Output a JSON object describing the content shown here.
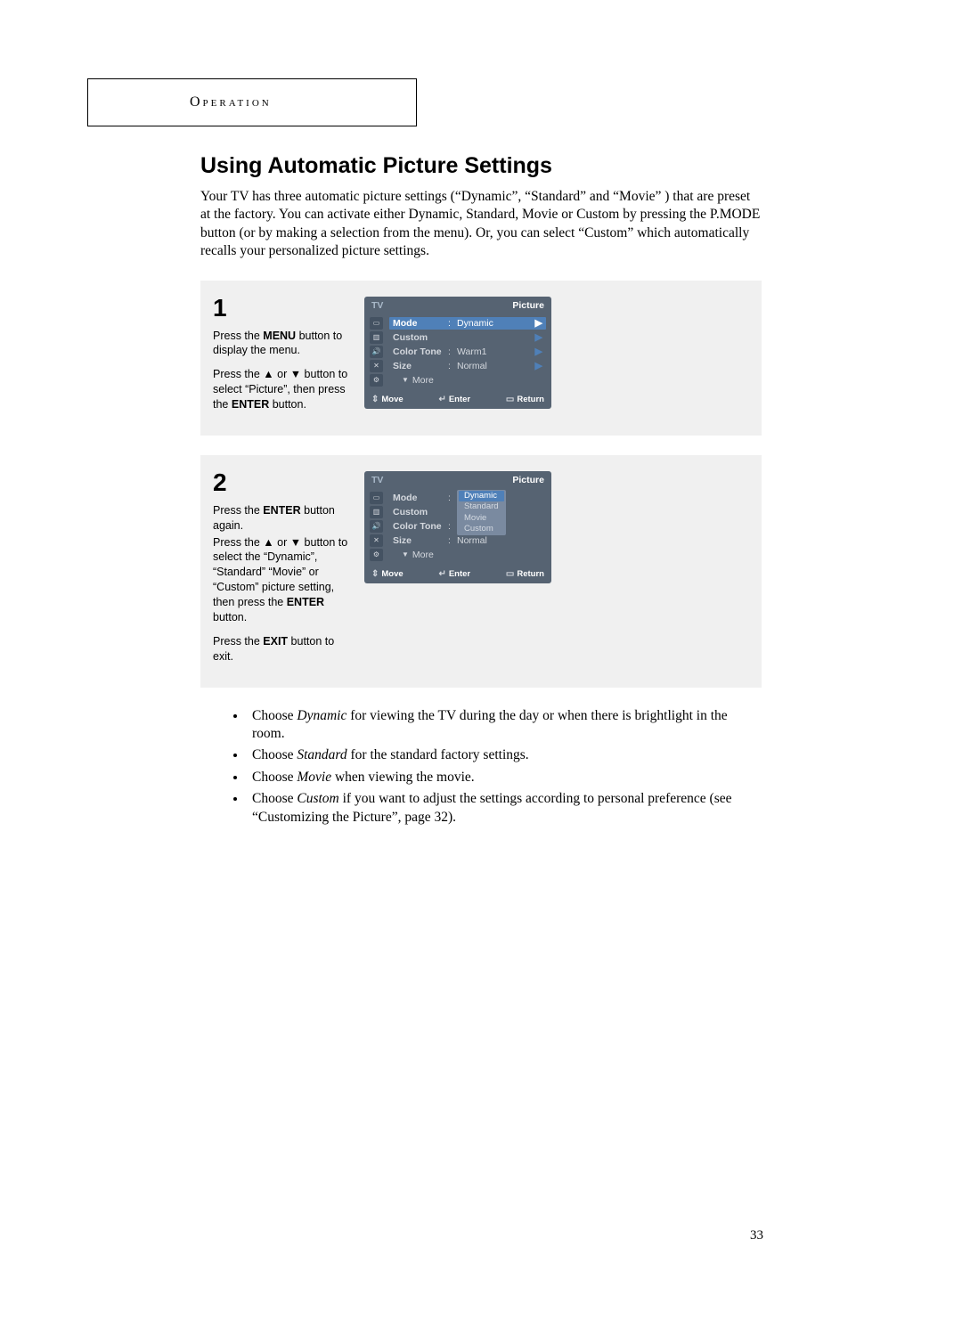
{
  "header": "Operation",
  "title": "Using Automatic Picture Settings",
  "intro": "Your TV has three automatic picture settings (“Dynamic”, “Standard” and “Movie” ) that are preset at the factory. You can activate either Dynamic, Standard, Movie or Custom by pressing the P.MODE button (or by making a selection from the menu). Or, you can select “Custom” which automatically recalls your personalized picture settings.",
  "steps": [
    {
      "num": "1",
      "instructions": [
        {
          "pre": "Press the ",
          "bold": "MENU",
          "post": " button to display the menu."
        },
        {
          "pre": "Press the ▲ or ▼ button to select “Picture”, then press the ",
          "bold": "ENTER",
          "post": " button."
        }
      ],
      "osd": {
        "tv": "TV",
        "title": "Picture",
        "rows": [
          {
            "label": "Mode",
            "val": "Dynamic",
            "hl": true,
            "arrow": true
          },
          {
            "label": "Custom",
            "val": "",
            "arrow": true
          },
          {
            "label": "Color Tone",
            "val": "Warm1",
            "arrow": true
          },
          {
            "label": "Size",
            "val": "Normal",
            "arrow": true
          }
        ],
        "more": "More",
        "footer": {
          "move": "Move",
          "enter": "Enter",
          "ret": "Return"
        }
      }
    },
    {
      "num": "2",
      "instructions": [
        {
          "pre": "Press the ",
          "bold": "ENTER",
          "post": " button again."
        },
        {
          "pre": "Press the ▲ or ▼ button to select the “Dynamic”, “Standard” “Movie” or “Custom” picture setting, then press the ",
          "bold": "ENTER",
          "post": " button."
        },
        {
          "pre": "Press the ",
          "bold": "EXIT",
          "post": " button to exit."
        }
      ],
      "osd": {
        "tv": "TV",
        "title": "Picture",
        "rows": [
          {
            "label": "Mode",
            "val": "",
            "dd": true
          },
          {
            "label": "Custom",
            "val": ""
          },
          {
            "label": "Color Tone",
            "val": ""
          },
          {
            "label": "Size",
            "val": "Normal"
          }
        ],
        "dropdown": [
          "Dynamic",
          "Standard",
          "Movie",
          "Custom"
        ],
        "dd_selected": "Dynamic",
        "more": "More",
        "footer": {
          "move": "Move",
          "enter": "Enter",
          "ret": "Return"
        }
      }
    }
  ],
  "bullets": [
    {
      "pre": "Choose ",
      "em": "Dynamic",
      "post": " for viewing the TV during the day or when there is brightlight in the room."
    },
    {
      "pre": "Choose ",
      "em": "Standard",
      "post": " for the standard factory settings."
    },
    {
      "pre": "Choose ",
      "em": "Movie",
      "post": " when viewing the movie."
    },
    {
      "pre": "Choose ",
      "em": "Custom",
      "post": " if you want to adjust the settings according to personal preference (see “Customizing the Picture”, page 32)."
    }
  ],
  "page_number": "33"
}
